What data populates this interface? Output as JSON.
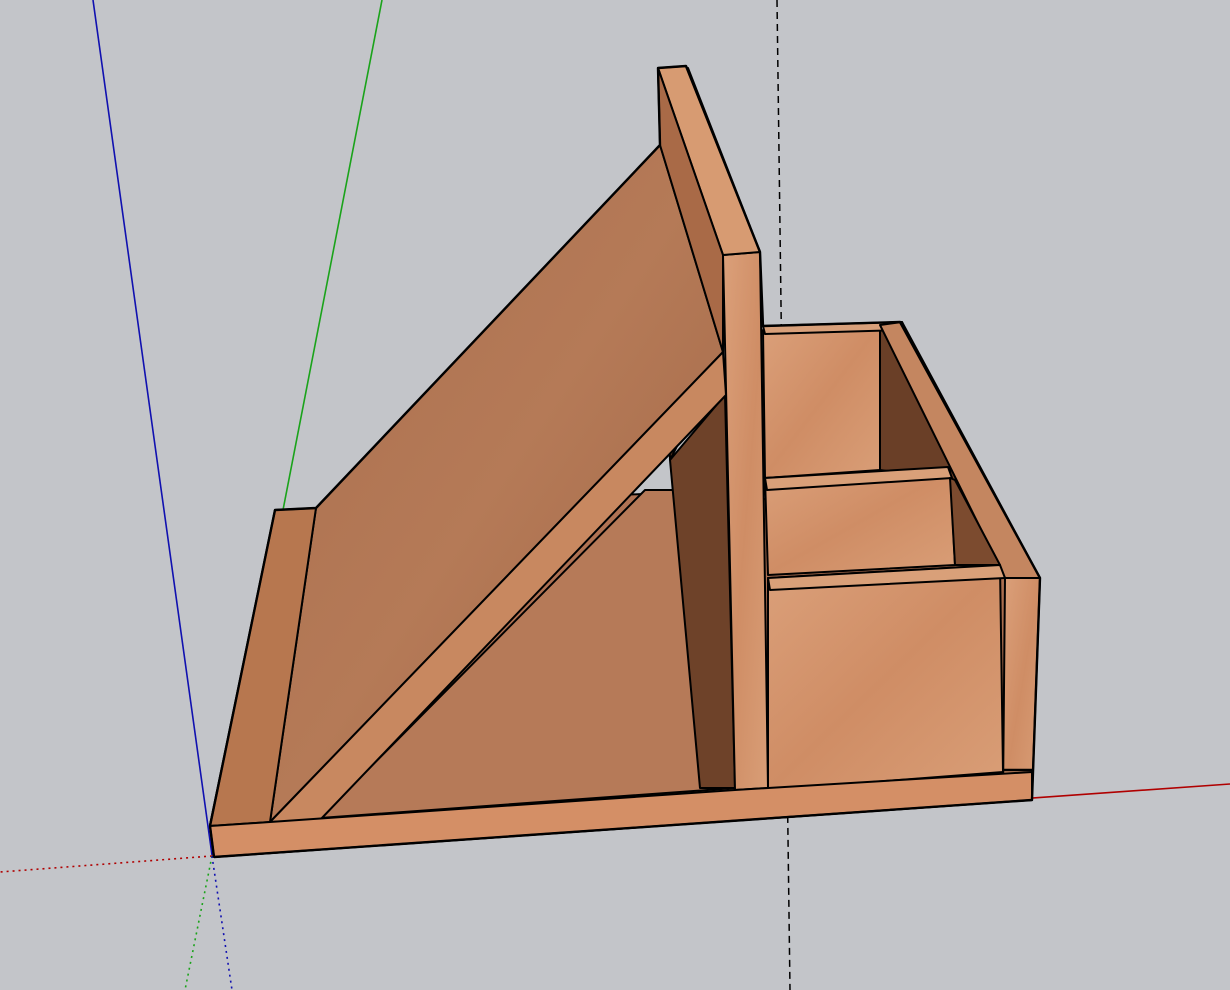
{
  "viewport": {
    "background": "#c3c5c9",
    "model": "wooden-tablet-stand-with-organizer"
  },
  "axes": {
    "red_axis_color": "#b00000",
    "green_axis_color": "#1aa31a",
    "blue_axis_color": "#1010b0",
    "guide_line_color": "#000000"
  },
  "materials": {
    "wood_light": "#d3916a",
    "wood_mid": "#b7774f",
    "wood_dark": "#8a5637",
    "wood_shadow": "#6a3f27"
  }
}
